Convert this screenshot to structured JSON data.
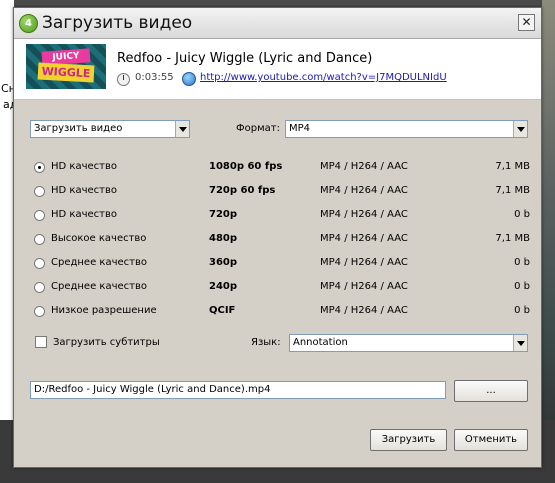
{
  "background": {
    "peek_line1": "Сн",
    "peek_line2": "ад"
  },
  "window": {
    "title": "Загрузить видео",
    "app_icon_glyph": "4",
    "close_glyph": "✕"
  },
  "video": {
    "title": "Redfoo - Juicy Wiggle (Lyric and Dance)",
    "duration": "0:03:55",
    "url": "http://www.youtube.com/watch?v=J7MQDULNIdU",
    "thumb_text_top": "JUICY",
    "thumb_text_bottom": "WIGGLE"
  },
  "controls": {
    "action_select": "Загрузить видео",
    "format_label": "Формат:",
    "format_select": "MP4"
  },
  "qualities": [
    {
      "quality": "HD качество",
      "resolution": "1080p 60 fps",
      "codec": "MP4 / H264 / AAC",
      "size": "7,1 MB",
      "selected": true
    },
    {
      "quality": "HD качество",
      "resolution": "720p 60 fps",
      "codec": "MP4 / H264 / AAC",
      "size": "7,1 MB",
      "selected": false
    },
    {
      "quality": "HD качество",
      "resolution": "720p",
      "codec": "MP4 / H264 / AAC",
      "size": "0 b",
      "selected": false
    },
    {
      "quality": "Высокое качество",
      "resolution": "480p",
      "codec": "MP4 / H264 / AAC",
      "size": "7,1 MB",
      "selected": false
    },
    {
      "quality": "Среднее качество",
      "resolution": "360p",
      "codec": "MP4 / H264 / AAC",
      "size": "0 b",
      "selected": false
    },
    {
      "quality": "Среднее качество",
      "resolution": "240p",
      "codec": "MP4 / H264 / AAC",
      "size": "0 b",
      "selected": false
    },
    {
      "quality": "Низкое разрешение",
      "resolution": "QCIF",
      "codec": "MP4 / H264 / AAC",
      "size": "0 b",
      "selected": false
    }
  ],
  "subtitles": {
    "checkbox_label": "Загрузить субтитры",
    "checked": false,
    "language_label": "Язык:",
    "language_select": "Annotation"
  },
  "output": {
    "path": "D:/Redfoo - Juicy Wiggle (Lyric and Dance).mp4",
    "browse_label": "..."
  },
  "buttons": {
    "download": "Загрузить",
    "cancel": "Отменить"
  }
}
